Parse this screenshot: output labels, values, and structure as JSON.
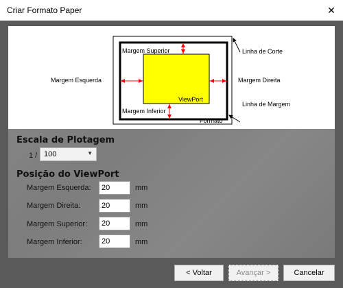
{
  "window": {
    "title": "Criar Formato Paper",
    "close_glyph": "✕"
  },
  "diagram": {
    "labels": {
      "top_margin": "Margem Superior",
      "left_margin": "Margem Esquerda",
      "right_margin": "Margem Direita",
      "bottom_margin": "Margem Inferior",
      "viewport": "ViewPort",
      "format": "Formato",
      "cut_line": "Linha de Corte",
      "margin_line": "Linha de Margem"
    },
    "colors": {
      "viewport_fill": "#ffff00",
      "arrow": "#ff0000"
    }
  },
  "plot_scale": {
    "title": "Escala de Plotagem",
    "prefix": "1 /",
    "selected": "100",
    "chevron_icon": "chevron-down-icon"
  },
  "viewport_position": {
    "title": "Posição do ViewPort",
    "fields": [
      {
        "label": "Margem Esquerda:",
        "value": "20",
        "unit": "mm"
      },
      {
        "label": "Margem Direita:",
        "value": "20",
        "unit": "mm"
      },
      {
        "label": "Margem Superior:",
        "value": "20",
        "unit": "mm"
      },
      {
        "label": "Margem Inferior:",
        "value": "20",
        "unit": "mm"
      }
    ]
  },
  "buttons": {
    "back": "< Voltar",
    "next": "Avançar >",
    "cancel": "Cancelar"
  }
}
